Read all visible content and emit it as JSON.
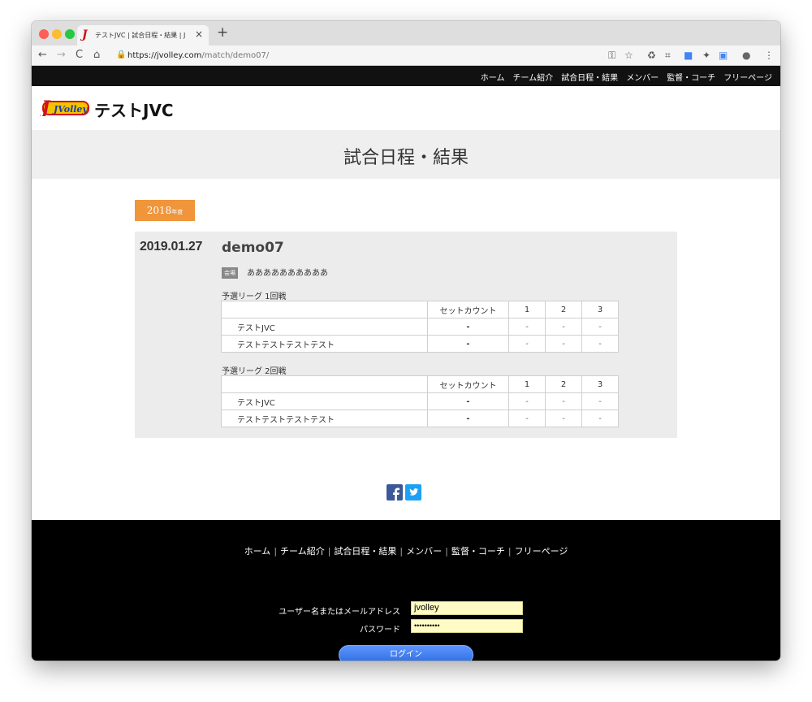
{
  "browser": {
    "tab_title": "テストJVC | 試合日程・結果 | J",
    "tab_close": "×",
    "new_tab": "+",
    "url_host": "https://jvolley.com",
    "url_path": "/match/demo07/",
    "nav": {
      "back": "←",
      "forward": "→",
      "reload": "C",
      "home": "⌂"
    }
  },
  "topnav": [
    "ホーム",
    "チーム紹介",
    "試合日程・結果",
    "メンバー",
    "監督・コーチ",
    "フリーページ"
  ],
  "site": {
    "name": "テストJVC",
    "logo_text": "JVolley"
  },
  "page_title": "試合日程・結果",
  "season": {
    "year": "2018",
    "suffix": "年度"
  },
  "match": {
    "date": "2019.01.27",
    "name": "demo07",
    "venue_tag": "会場",
    "venue": "ああああああああああ",
    "leagues": [
      {
        "label": "予選リーグ 1回戦",
        "header": [
          "",
          "セットカウント",
          "1",
          "2",
          "3"
        ],
        "rows": [
          [
            "テストJVC",
            "-",
            "-",
            "-",
            "-"
          ],
          [
            "テストテストテストテスト",
            "-",
            "-",
            "-",
            "-"
          ]
        ]
      },
      {
        "label": "予選リーグ 2回戦",
        "header": [
          "",
          "セットカウント",
          "1",
          "2",
          "3"
        ],
        "rows": [
          [
            "テストJVC",
            "-",
            "-",
            "-",
            "-"
          ],
          [
            "テストテストテストテスト",
            "-",
            "-",
            "-",
            "-"
          ]
        ]
      }
    ]
  },
  "footer": {
    "nav": [
      "ホーム",
      "チーム紹介",
      "試合日程・結果",
      "メンバー",
      "監督・コーチ",
      "フリーページ"
    ],
    "separator": "|",
    "username_label": "ユーザー名またはメールアドレス",
    "username_value": "jvolley",
    "password_label": "パスワード",
    "password_value": "••••••••••",
    "login_button": "ログイン"
  },
  "colors": {
    "accent_orange": "#f0953a",
    "facebook": "#3b5998",
    "twitter": "#1da1f2",
    "login_button": "#2c6ce0"
  }
}
